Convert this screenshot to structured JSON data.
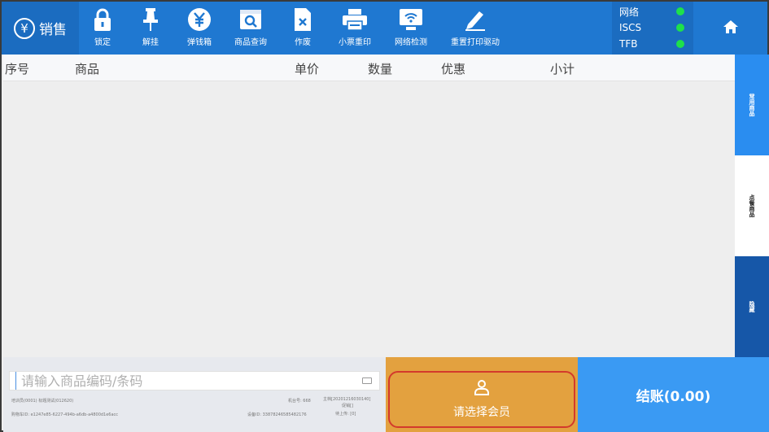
{
  "app": {
    "title": "销售"
  },
  "toolbar": {
    "lock": "锁定",
    "unhold": "解挂",
    "cashbox": "弹钱箱",
    "product_query": "商品查询",
    "void": "作废",
    "reprint": "小票重印",
    "net_check": "网络检测",
    "reset_printer": "重置打印驱动"
  },
  "status": [
    {
      "label": "网络",
      "color": "#1ee04b"
    },
    {
      "label": "ISCS",
      "color": "#1ee04b"
    },
    {
      "label": "TFB",
      "color": "#1ee04b"
    }
  ],
  "table": {
    "columns": [
      "序号",
      "商品",
      "单价",
      "数量",
      "优惠",
      "小计"
    ],
    "rows": []
  },
  "side_tabs": {
    "common": "常用商品",
    "order": "点餐商品",
    "hide": "隐藏"
  },
  "search": {
    "placeholder": "请输入商品编码/条码"
  },
  "info": {
    "cashier": "培训员(0001) 标题测试(012620)",
    "machine": "机台号: 668",
    "version": "主档[20201216030140]",
    "promo": "促销[]",
    "pending": "待上传: [0]",
    "cart": "购物车ID: e1247e85-6227-494b-a6db-a4800d1e6acc",
    "device": "设备ID: 33878246585482176"
  },
  "member": {
    "label": "请选择会员"
  },
  "checkout": {
    "label": "结账(0.00)"
  },
  "colors": {
    "topbar": "#1f78d1",
    "member": "#e3a13f",
    "checkout": "#3a9af3",
    "status_ok": "#1ee04b"
  }
}
